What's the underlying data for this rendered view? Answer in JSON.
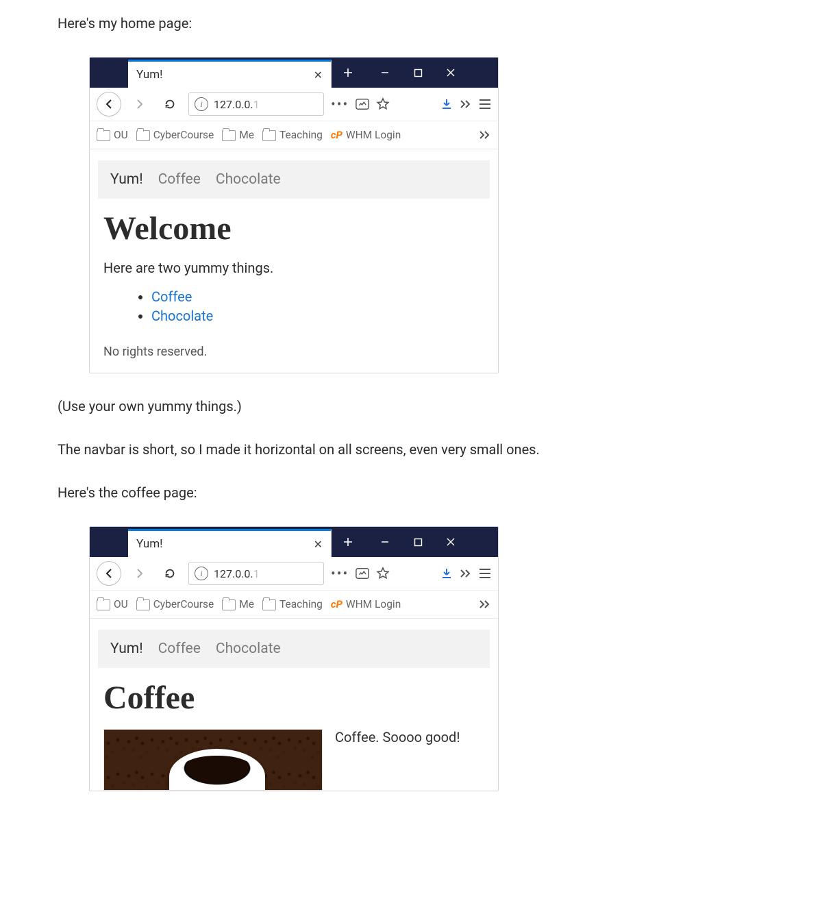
{
  "doc": {
    "intro1": "Here's my home page:",
    "intro2": "(Use your own yummy things.)",
    "intro3": "The navbar is short, so I made it horizontal on all screens, even very small ones.",
    "intro4": "Here's the coffee page:"
  },
  "browser": {
    "tab_title": "Yum!",
    "url_visible": "127.0.0.",
    "url_faded": "1",
    "bookmarks": [
      "OU",
      "CyberCourse",
      "Me",
      "Teaching",
      "WHM Login"
    ]
  },
  "homepage": {
    "brand": "Yum!",
    "nav": [
      "Coffee",
      "Chocolate"
    ],
    "heading": "Welcome",
    "lead": "Here are two yummy things.",
    "links": [
      "Coffee",
      "Chocolate"
    ],
    "footer": "No rights reserved."
  },
  "coffeepage": {
    "brand": "Yum!",
    "nav": [
      "Coffee",
      "Chocolate"
    ],
    "heading": "Coffee",
    "caption": "Coffee. Soooo good!"
  }
}
